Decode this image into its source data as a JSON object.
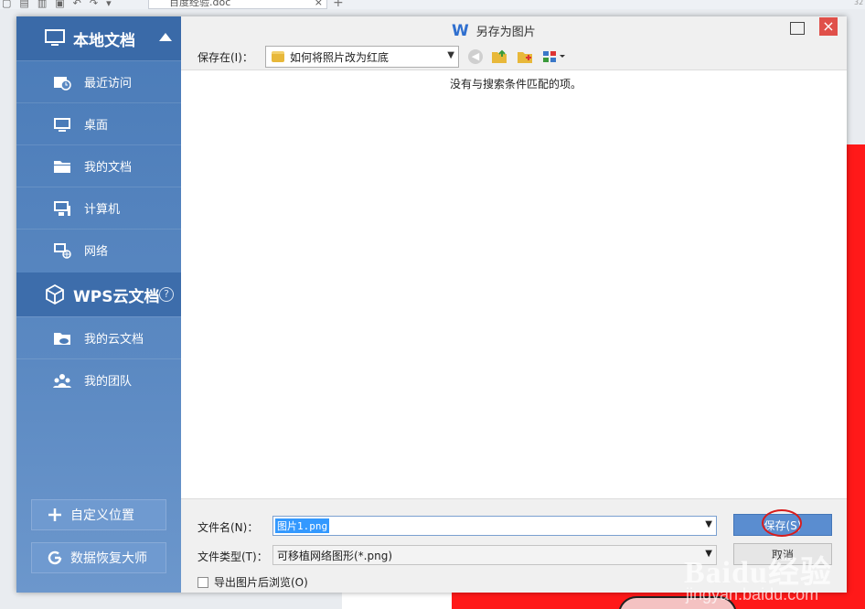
{
  "background_app": {
    "tab_title": "百度经验.doc",
    "tab_close": "×",
    "new_tab": "+",
    "version": "32"
  },
  "dialog": {
    "title": "另存为图片",
    "logo": "W",
    "close": "×",
    "sidebar": {
      "local_section": "本地文档",
      "local_items": [
        {
          "label": "最近访问",
          "icon": "recent-icon"
        },
        {
          "label": "桌面",
          "icon": "desktop-icon"
        },
        {
          "label": "我的文档",
          "icon": "documents-icon"
        },
        {
          "label": "计算机",
          "icon": "computer-icon"
        },
        {
          "label": "网络",
          "icon": "network-icon"
        }
      ],
      "cloud_section": "WPS云文档",
      "cloud_help": "?",
      "cloud_items": [
        {
          "label": "我的云文档",
          "icon": "cloud-docs-icon"
        },
        {
          "label": "我的团队",
          "icon": "team-icon"
        }
      ],
      "custom_location": "自定义位置",
      "data_recovery": "数据恢复大师"
    },
    "location": {
      "label": "保存在(I)：",
      "value": "如何将照片改为红底"
    },
    "empty_message": "没有与搜索条件匹配的项。",
    "filename": {
      "label": "文件名(N)：",
      "value": "图片1.png"
    },
    "filetype": {
      "label": "文件类型(T)：",
      "value": "可移植网络图形(*.png)"
    },
    "save_button": "保存(S)",
    "cancel_button": "取消",
    "open_after_export": "导出图片后浏览(O)"
  },
  "watermark": {
    "brand": "Baidu经验",
    "url": "jingyan.baidu.com"
  }
}
